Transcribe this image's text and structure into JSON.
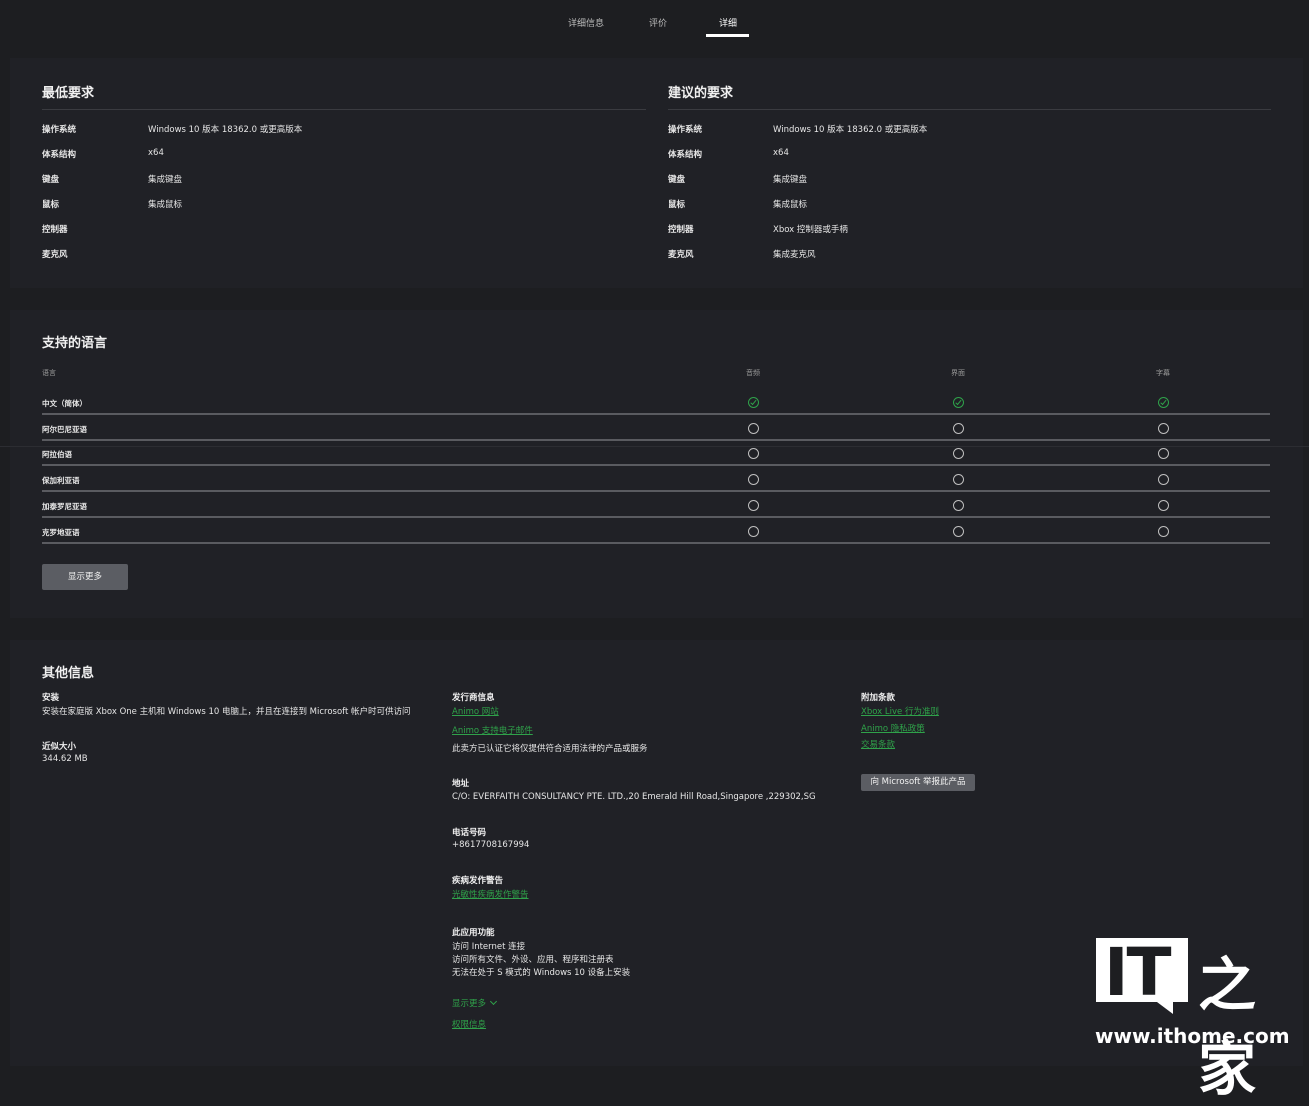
{
  "tabs": [
    {
      "label": "详细信息",
      "active": false
    },
    {
      "label": "评价",
      "active": false
    },
    {
      "label": "详细",
      "active": true
    }
  ],
  "min_requirements": {
    "title": "最低要求",
    "rows": [
      {
        "label": "操作系统",
        "value": "Windows 10 版本 18362.0 或更高版本"
      },
      {
        "label": "体系结构",
        "value": "x64"
      },
      {
        "label": "键盘",
        "value": "集成键盘"
      },
      {
        "label": "鼠标",
        "value": "集成鼠标"
      },
      {
        "label": "控制器",
        "value": ""
      },
      {
        "label": "麦克风",
        "value": ""
      }
    ]
  },
  "rec_requirements": {
    "title": "建议的要求",
    "rows": [
      {
        "label": "操作系统",
        "value": "Windows 10 版本 18362.0 或更高版本"
      },
      {
        "label": "体系结构",
        "value": "x64"
      },
      {
        "label": "键盘",
        "value": "集成键盘"
      },
      {
        "label": "鼠标",
        "value": "集成鼠标"
      },
      {
        "label": "控制器",
        "value": "Xbox 控制器或手柄"
      },
      {
        "label": "麦克风",
        "value": "集成麦克风"
      }
    ]
  },
  "languages": {
    "title": "支持的语言",
    "headers": {
      "language": "语言",
      "audio": "音频",
      "interface": "界面",
      "subtitles": "字幕"
    },
    "rows": [
      {
        "name": "中文（简体）",
        "audio": true,
        "interface": true,
        "subtitles": true
      },
      {
        "name": "阿尔巴尼亚语",
        "audio": false,
        "interface": false,
        "subtitles": false
      },
      {
        "name": "阿拉伯语",
        "audio": false,
        "interface": false,
        "subtitles": false
      },
      {
        "name": "保加利亚语",
        "audio": false,
        "interface": false,
        "subtitles": false
      },
      {
        "name": "加泰罗尼亚语",
        "audio": false,
        "interface": false,
        "subtitles": false
      },
      {
        "name": "克罗地亚语",
        "audio": false,
        "interface": false,
        "subtitles": false
      }
    ],
    "show_more": "显示更多"
  },
  "other_info": {
    "title": "其他信息",
    "install_label": "安装",
    "install_text": "安装在家庭版 Xbox One 主机和 Windows 10 电脑上，并且在连接到 Microsoft 帐户时可供访问",
    "size_label": "近似大小",
    "size_value": "344.62 MB",
    "publisher_label": "发行商信息",
    "publisher_links": [
      "Animo 网站",
      "Animo 支持电子邮件"
    ],
    "publisher_note": "此卖方已认证它将仅提供符合适用法律的产品或服务",
    "address_label": "地址",
    "address_value": "C/O: EVERFAITH CONSULTANCY PTE. LTD.,20 Emerald Hill Road,Singapore ,229302,SG",
    "phone_label": "电话号码",
    "phone_value": "+8617708167994",
    "seizure_label": "疾病发作警告",
    "seizure_link": "光敏性疾病发作警告",
    "features_label": "此应用功能",
    "features": [
      "访问 Internet 连接",
      "访问所有文件、外设、应用、程序和注册表",
      "无法在处于 S 模式的 Windows 10 设备上安装"
    ],
    "features_more": "显示更多",
    "permissions_link": "权限信息",
    "terms_label": "附加条款",
    "terms_links": [
      "Xbox Live 行为准则",
      "Animo 隐私政策",
      "交易条款"
    ],
    "report_button": "向 Microsoft 举报此产品"
  },
  "watermark": {
    "logo": "IT",
    "cn": "之家",
    "url": "www.ithome.com"
  }
}
